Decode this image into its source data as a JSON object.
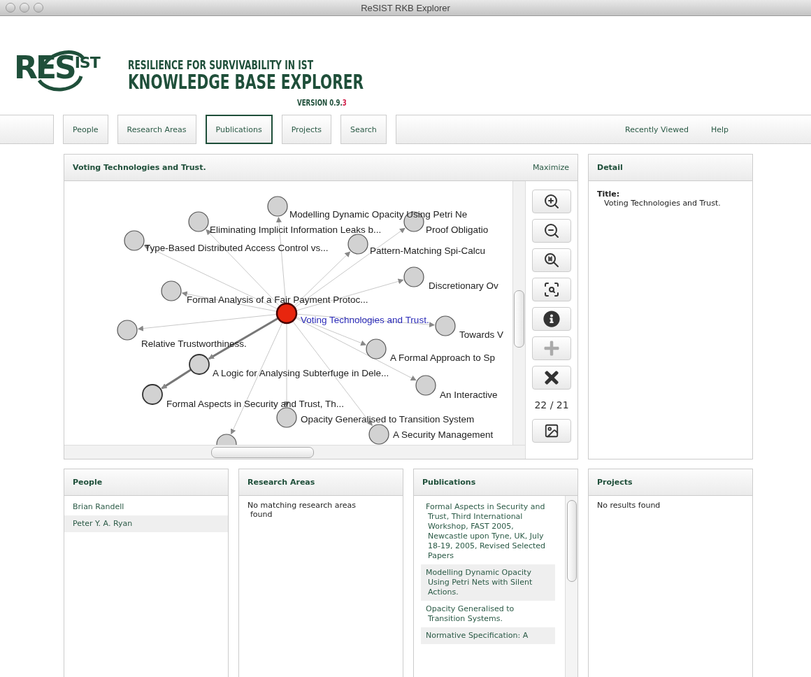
{
  "window": {
    "title": "ReSIST RKB Explorer"
  },
  "header": {
    "logo": {
      "main": "RES",
      "sup": "IST"
    },
    "tagline": "RESILIENCE FOR SURVIVABILITY IN IST",
    "title": "KNOWLEDGE BASE EXPLORER",
    "version": {
      "text": "VERSION 0.9.",
      "highlight": "3"
    }
  },
  "tabs": [
    {
      "label": "People",
      "selected": false
    },
    {
      "label": "Research Areas",
      "selected": false
    },
    {
      "label": "Publications",
      "selected": true
    },
    {
      "label": "Projects",
      "selected": false
    },
    {
      "label": "Search",
      "selected": false
    }
  ],
  "links": [
    "Recently Viewed",
    "Help"
  ],
  "graph_panel": {
    "title": "Voting Technologies and Trust.",
    "action": "Maximize",
    "nodes": [
      {
        "label": "Modelling Dynamic Opacity Using Petri Ne",
        "selected": false,
        "highlighted": false
      },
      {
        "label": "Eliminating Implicit Information Leaks b...",
        "selected": false,
        "highlighted": false
      },
      {
        "label": "Proof Obligatio",
        "selected": false,
        "highlighted": false
      },
      {
        "label": "Type-Based Distributed Access Control vs...",
        "selected": false,
        "highlighted": false
      },
      {
        "label": "Pattern-Matching Spi-Calcu",
        "selected": false,
        "highlighted": false
      },
      {
        "label": "Discretionary Ov",
        "selected": false,
        "highlighted": false
      },
      {
        "label": "Formal Analysis of a Fair Payment Protoc...",
        "selected": false,
        "highlighted": false
      },
      {
        "label": "Voting Technologies and Trust.",
        "selected": true,
        "highlighted": false
      },
      {
        "label": "Towards V",
        "selected": false,
        "highlighted": false
      },
      {
        "label": "Relative Trustworthiness.",
        "selected": false,
        "highlighted": false
      },
      {
        "label": "A Formal Approach to Sp",
        "selected": false,
        "highlighted": false
      },
      {
        "label": "A Logic for Analysing Subterfuge in Dele...",
        "selected": false,
        "highlighted": true
      },
      {
        "label": "An Interactive",
        "selected": false,
        "highlighted": false
      },
      {
        "label": "Formal Aspects in Security and Trust, Th...",
        "selected": false,
        "highlighted": true
      },
      {
        "label": "Opacity Generalised to Transition System",
        "selected": false,
        "highlighted": false
      },
      {
        "label": "A Security Management",
        "selected": false,
        "highlighted": false
      },
      {
        "selected": false,
        "highlighted": false
      }
    ],
    "toolbar": [
      {
        "kind": "zoom_in",
        "disabled": false
      },
      {
        "kind": "zoom_out",
        "disabled": false
      },
      {
        "kind": "actual_size",
        "disabled": false
      },
      {
        "kind": "fit",
        "disabled": false
      },
      {
        "kind": "info",
        "disabled": false
      },
      {
        "kind": "add",
        "disabled": true
      },
      {
        "kind": "remove",
        "disabled": false
      },
      {
        "kind": "image",
        "disabled": false
      }
    ],
    "counter": "22 / 21"
  },
  "detail_panel": {
    "title": "Detail",
    "field_label": "Title:",
    "field_value": "Voting Technologies and Trust."
  },
  "lists": [
    {
      "title": "People",
      "kind": "items",
      "items": [
        "Brian Randell",
        "Peter Y. A. Ryan"
      ]
    },
    {
      "title": "Research Areas",
      "kind": "message",
      "message": "No matching research areas found"
    },
    {
      "title": "Publications",
      "kind": "items",
      "items": [
        "Formal Aspects in Security and Trust, Third International Workshop, FAST 2005, Newcastle upon Tyne, UK, July 18-19, 2005, Revised Selected Papers",
        "Modelling Dynamic Opacity Using Petri Nets with Silent Actions.",
        "Opacity Generalised to Transition Systems.",
        "Normative Specification: A"
      ],
      "scrollable": true
    },
    {
      "title": "Projects",
      "kind": "message",
      "message": "No results found"
    }
  ]
}
